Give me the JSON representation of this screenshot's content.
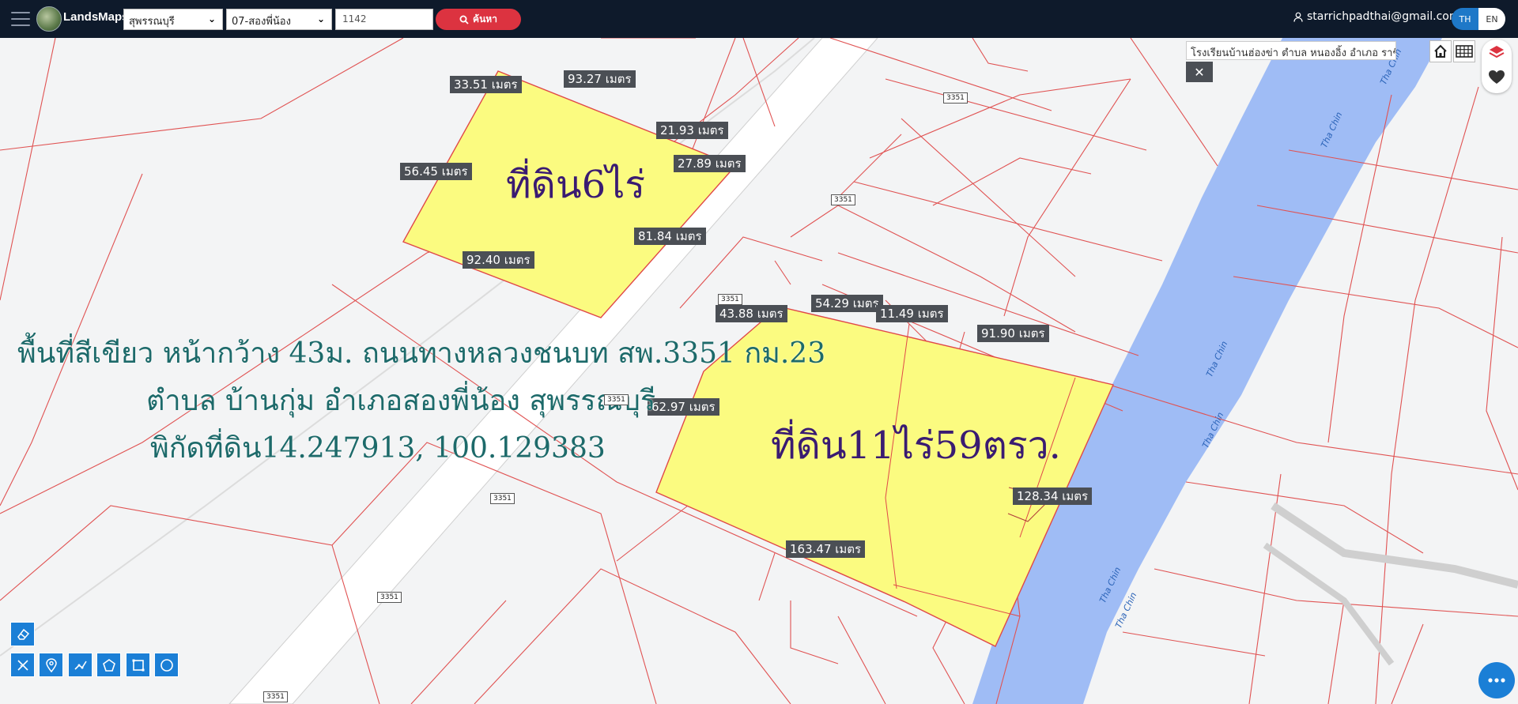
{
  "navbar": {
    "brand": "LandsMaps",
    "province": "สุพรรณบุรี",
    "district": "07-สองพี่น้อง",
    "parcel_no": "1142",
    "search_label": "ค้นหา",
    "user_email": "starrichpadthai@gmail.com",
    "lang_th": "TH",
    "lang_en": "EN"
  },
  "map": {
    "info_text": "โรงเรียนบ้านฮ่องข่า ตำบล หนองอิ้ง อำเภอ ราชิ",
    "close_label": "✕",
    "plot_small": {
      "label": "ที่ดิน6ไร่",
      "measurements": [
        "33.51 เมตร",
        "93.27 เมตร",
        "21.93 เมตร",
        "27.89 เมตร",
        "56.45 เมตร",
        "81.84 เมตร",
        "92.40 เมตร"
      ]
    },
    "plot_large": {
      "label": "ที่ดิน11ไร่59ตรว.",
      "measurements": [
        "43.88 เมตร",
        "54.29 เมตร",
        "11.49 เมตร",
        "91.90 เมตร",
        "62.97 เมตร",
        "128.34 เมตร",
        "163.47 เมตร"
      ]
    },
    "description": [
      "พื้นที่สีเขียว หน้ากว้าง 43ม. ถนนทางหลวงชนบท สพ.3351 กม.23",
      "ตำบล บ้านกุ่ม อำเภอสองพี่น้อง สุพรรณบุรี",
      "พิกัดที่ดิน14.247913, 100.129383"
    ],
    "road_label": "3351",
    "river_label": "Tha Chin"
  },
  "colors": {
    "navbar": "#0e1a2b",
    "search_button": "#dc3340",
    "parcel_fill": "#fbfb80",
    "parcel_border": "#e04848",
    "river": "#9fbcf5",
    "accent": "#1b7fd6"
  }
}
